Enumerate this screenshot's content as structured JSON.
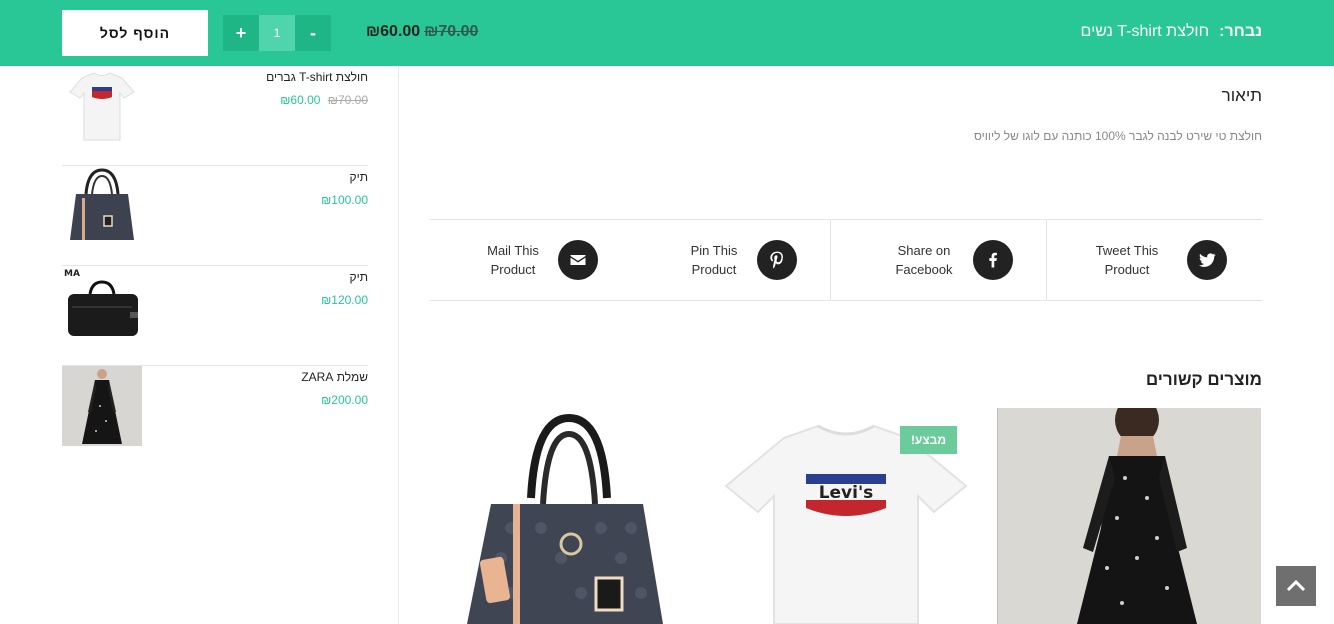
{
  "sticky_bar": {
    "chosen_label": "נבחר:",
    "chosen_product": "חולצת T-shirt נשים",
    "price_new": "₪60.00",
    "price_old": "₪70.00",
    "qty_plus": "+",
    "qty_value": "1",
    "qty_minus": "-",
    "add_to_cart": "הוסף לסל",
    "colors": {
      "bar": "#28c795",
      "accent": "#28c795"
    }
  },
  "sidebar": {
    "items": [
      {
        "name": "חולצת T-shirt גברים",
        "price_new": "₪60.00",
        "price_old": "₪70.00",
        "thumb": "white-tshirt-levis"
      },
      {
        "name": "תיק",
        "price_new": "₪100.00",
        "price_old": "",
        "thumb": "grey-monogram-handbag"
      },
      {
        "name": "תיק",
        "price_new": "₪120.00",
        "price_old": "",
        "thumb": "black-leather-bag"
      },
      {
        "name": "שמלת ZARA",
        "price_new": "₪200.00",
        "price_old": "",
        "thumb": "black-sheer-dress"
      }
    ],
    "brand_mark": "MA"
  },
  "description": {
    "title": "תיאור",
    "text": "חולצת טי שירט לבנה לגבר 100% כותנה עם לוגו של ליוויס"
  },
  "share": {
    "twitter": "Tweet This Product",
    "facebook": "Share on Facebook",
    "pinterest": "Pin This Product",
    "mail": "Mail This Product"
  },
  "related": {
    "title": "מוצרים קשורים",
    "sale_badge": "מבצע!",
    "logo_text": "Levi's"
  },
  "back_to_top_icon": "chevron-up-icon"
}
